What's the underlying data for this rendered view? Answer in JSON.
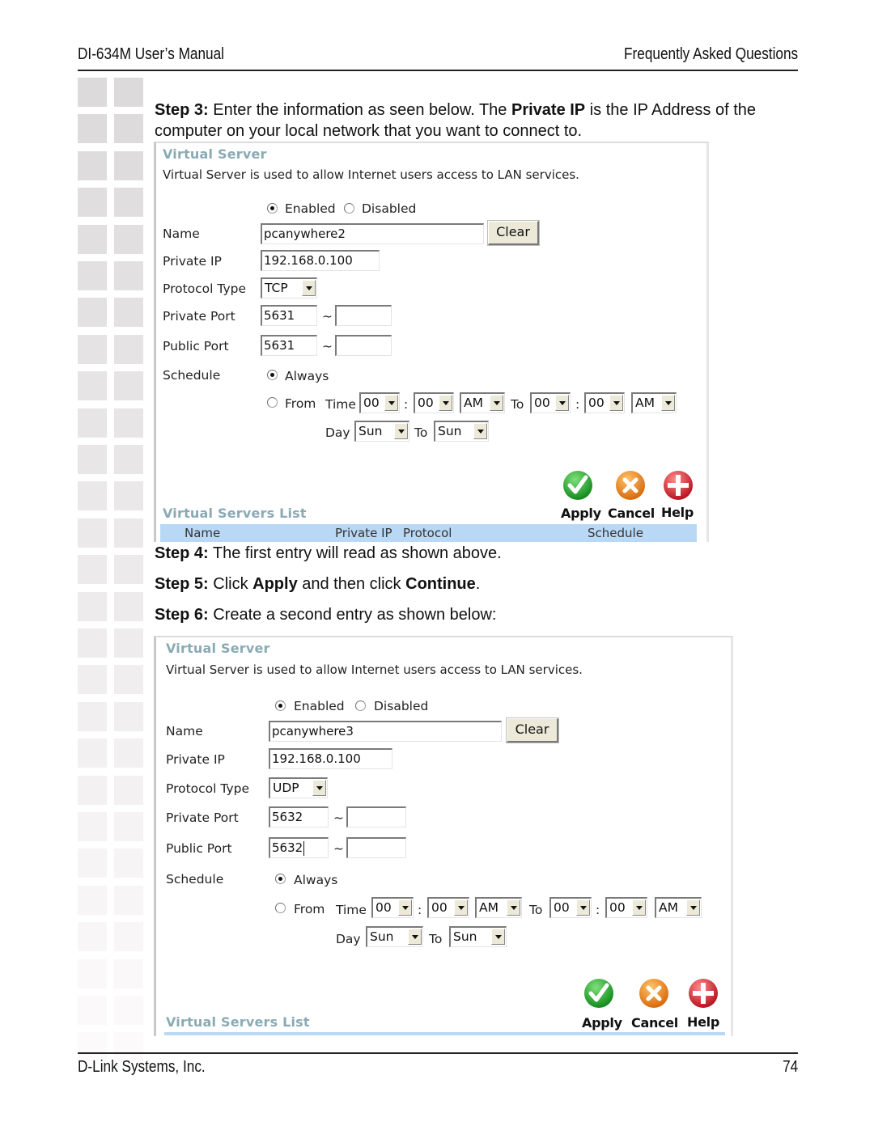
{
  "header": {
    "left": "DI-634M User’s Manual",
    "right": "Frequently Asked Questions"
  },
  "footer": {
    "left": "D-Link Systems, Inc.",
    "page_number": "74"
  },
  "steps": {
    "step3": {
      "label": "Step 3:",
      "text_a": " Enter the information as seen below. The ",
      "bold": "Private IP",
      "text_b": " is the IP Address of the",
      "text_line2": "computer on your local network that you want to connect to."
    },
    "step4": {
      "label": "Step 4:",
      "text": " The first entry will read as shown above."
    },
    "step5": {
      "label": "Step 5:",
      "text_a": " Click ",
      "bold_a": "Apply",
      "text_b": " and then click ",
      "bold_b": "Continue",
      "text_c": "."
    },
    "step6": {
      "label": "Step 6:",
      "text": " Create a second entry as shown below:"
    }
  },
  "panels": [
    {
      "title": "Virtual Server",
      "description": "Virtual Server is used to allow Internet users access to LAN services.",
      "enabled_label": "Enabled",
      "disabled_label": "Disabled",
      "enabled": true,
      "name_label": "Name",
      "name_value": "pcanywhere2",
      "clear_label": "Clear",
      "private_ip_label": "Private IP",
      "private_ip_value": "192.168.0.100",
      "protocol_label": "Protocol Type",
      "protocol_value": "TCP",
      "private_port_label": "Private Port",
      "private_port_start": "5631",
      "private_port_end": "",
      "public_port_label": "Public Port",
      "public_port_start": "5631",
      "public_port_end": "",
      "tilde": "~",
      "schedule_label": "Schedule",
      "always_label": "Always",
      "schedule_always": true,
      "from_label": "From",
      "time_label": "Time",
      "colon": ":",
      "to_label": "To",
      "day_label": "Day",
      "time_from_hour": "00",
      "time_from_min": "00",
      "time_from_ampm": "AM",
      "time_to_hour": "00",
      "time_to_min": "00",
      "time_to_ampm": "AM",
      "day_from": "Sun",
      "day_to": "Sun",
      "apply_label": "Apply",
      "cancel_label": "Cancel",
      "help_label": "Help",
      "list_title": "Virtual Servers List",
      "list_columns": [
        "Name",
        "Private IP",
        "Protocol",
        "Schedule"
      ]
    },
    {
      "title": "Virtual Server",
      "description": "Virtual Server is used to allow Internet users access to LAN services.",
      "enabled_label": "Enabled",
      "disabled_label": "Disabled",
      "enabled": true,
      "name_label": "Name",
      "name_value": "pcanywhere3",
      "clear_label": "Clear",
      "private_ip_label": "Private IP",
      "private_ip_value": "192.168.0.100",
      "protocol_label": "Protocol Type",
      "protocol_value": "UDP",
      "private_port_label": "Private Port",
      "private_port_start": "5632",
      "private_port_end": "",
      "public_port_label": "Public Port",
      "public_port_start": "5632",
      "public_port_end": "",
      "tilde": "~",
      "schedule_label": "Schedule",
      "always_label": "Always",
      "schedule_always": true,
      "from_label": "From",
      "time_label": "Time",
      "colon": ":",
      "to_label": "To",
      "day_label": "Day",
      "time_from_hour": "00",
      "time_from_min": "00",
      "time_from_ampm": "AM",
      "time_to_hour": "00",
      "time_to_min": "00",
      "time_to_ampm": "AM",
      "day_from": "Sun",
      "day_to": "Sun",
      "apply_label": "Apply",
      "cancel_label": "Cancel",
      "help_label": "Help",
      "list_title": "Virtual Servers List"
    }
  ],
  "icons": {
    "apply": "green-check-icon",
    "cancel": "orange-x-icon",
    "help": "red-plus-icon"
  },
  "colors": {
    "panel_title": "#8aaab3",
    "list_header_bg": "#b9d8f5",
    "apply_green": "#1faa2a",
    "cancel_orange": "#f0861a",
    "help_red": "#d8222e"
  }
}
